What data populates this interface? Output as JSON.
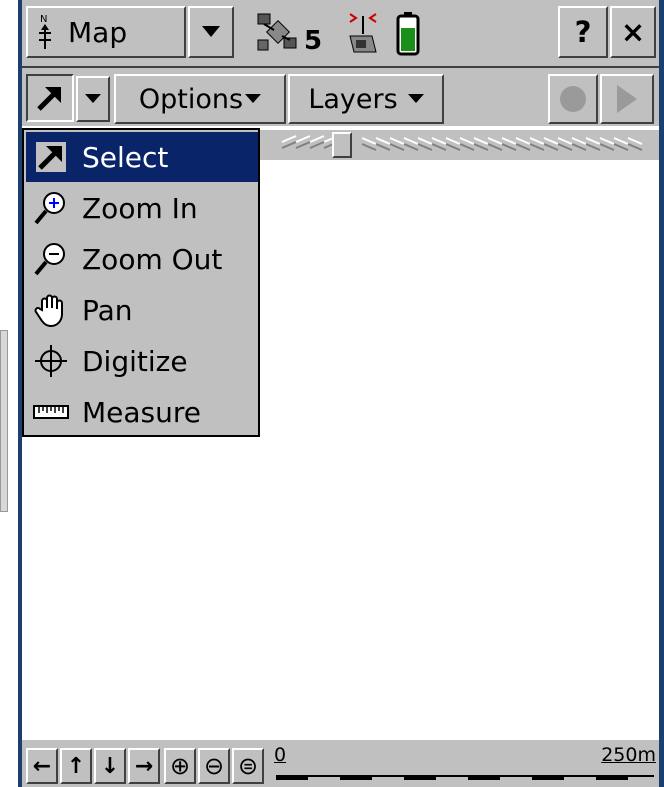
{
  "title_bar": {
    "app_label": "Map",
    "satellite_count": "5",
    "help_label": "?",
    "close_label": "×"
  },
  "toolbar": {
    "options_label": "Options",
    "layers_label": "Layers"
  },
  "tool_menu": {
    "items": [
      {
        "label": "Select",
        "icon": "select-arrow-icon",
        "selected": true
      },
      {
        "label": "Zoom In",
        "icon": "zoom-in-icon",
        "selected": false
      },
      {
        "label": "Zoom Out",
        "icon": "zoom-out-icon",
        "selected": false
      },
      {
        "label": "Pan",
        "icon": "pan-hand-icon",
        "selected": false
      },
      {
        "label": "Digitize",
        "icon": "crosshair-icon",
        "selected": false
      },
      {
        "label": "Measure",
        "icon": "ruler-icon",
        "selected": false
      }
    ]
  },
  "bottom_bar": {
    "arrows": [
      "←",
      "↑",
      "↓",
      "→"
    ],
    "zoom_in": "⊕",
    "zoom_out": "⊖",
    "zoom_extent": "⊜",
    "scale_start": "0",
    "scale_end": "250m"
  },
  "colors": {
    "face": "#c0c0c0",
    "selection": "#0a246a",
    "frame": "#1b3f6f",
    "battery": "#1a8f1a"
  }
}
